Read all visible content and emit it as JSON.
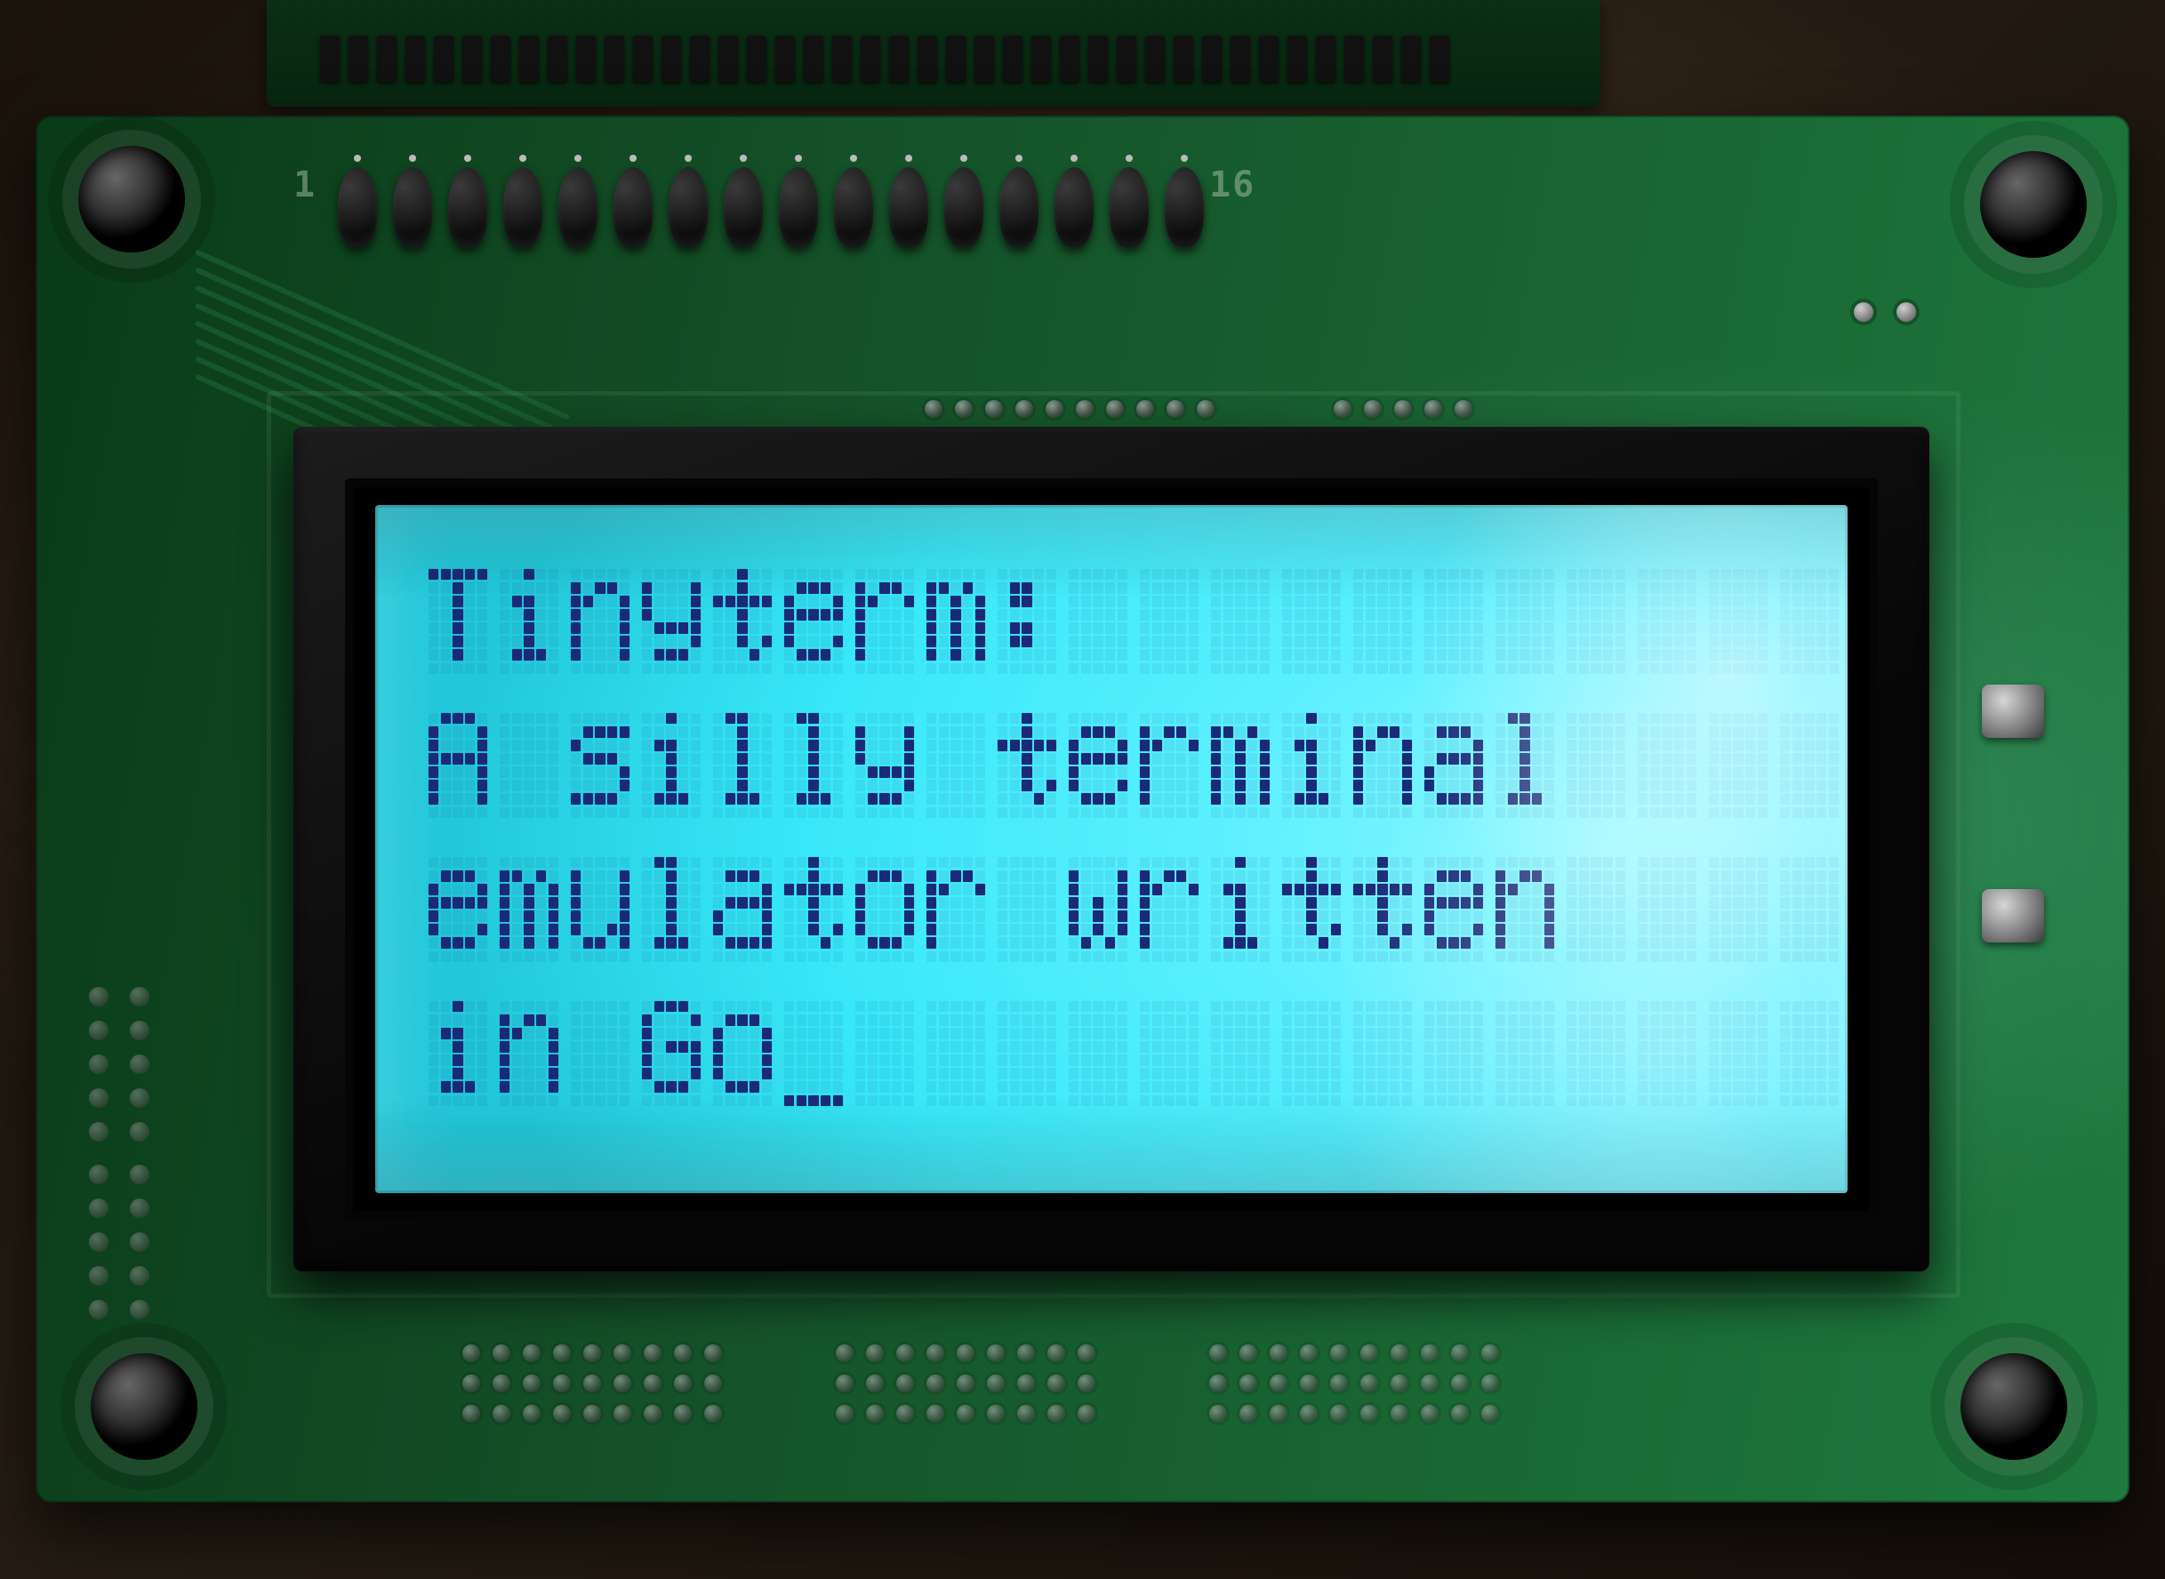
{
  "device": {
    "board_type": "HD44780 20x4 character LCD on green PCB",
    "header_pin_count": 16,
    "header_silk_left": "1",
    "header_silk_right": "16",
    "backlight_color": "#4ceaf9",
    "pixel_color": "#1a2a78"
  },
  "display": {
    "columns": 20,
    "rows": 4,
    "cursor": {
      "row": 3,
      "col": 5,
      "style": "underscore"
    },
    "lines": [
      "Tinyterm:",
      "A silly terminal",
      "emulator written",
      "in Go_"
    ]
  }
}
